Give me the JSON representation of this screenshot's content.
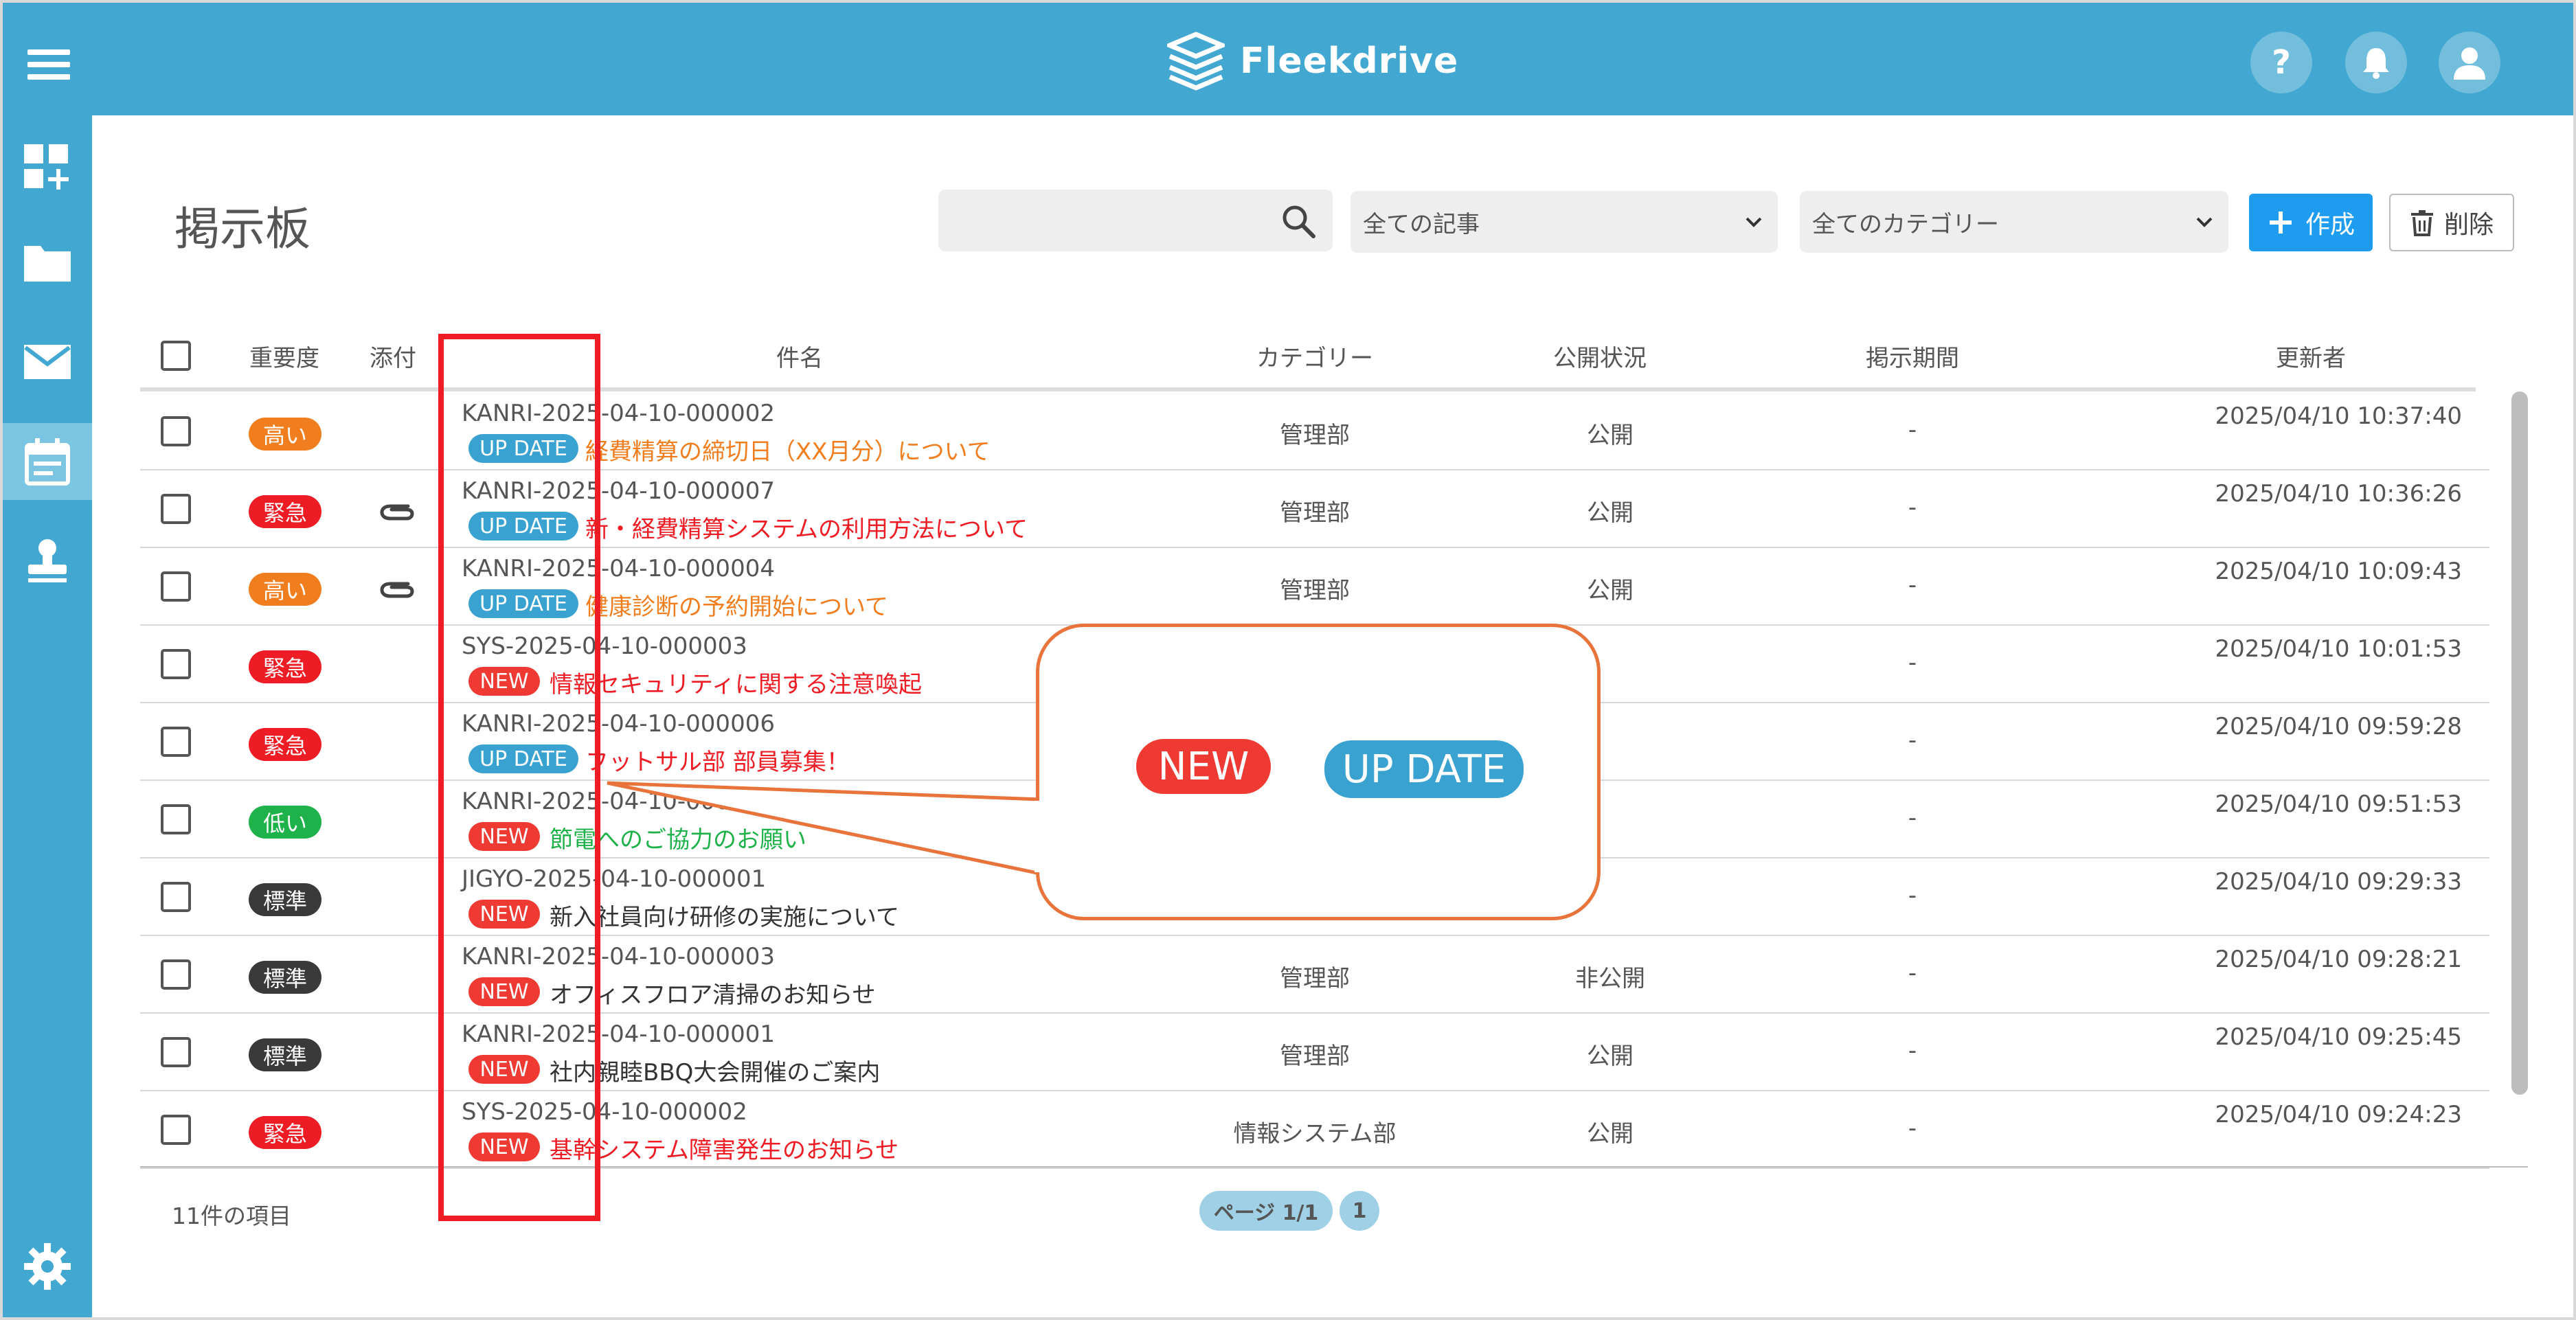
{
  "app": {
    "name": "Fleekdrive"
  },
  "header": {
    "help_label": "?"
  },
  "page": {
    "title": "掲示板"
  },
  "toolbar": {
    "search_placeholder": "",
    "filter_article": "全ての記事",
    "filter_category": "全てのカテゴリー",
    "create_label": "作成",
    "delete_label": "削除"
  },
  "table": {
    "headers": {
      "importance": "重要度",
      "attachment": "添付",
      "subject": "件名",
      "category": "カテゴリー",
      "status": "公開状況",
      "period": "掲示期間",
      "updated_by": "更新者"
    },
    "rows": [
      {
        "priority": "高い",
        "priority_color": "#f07e1e",
        "attach": false,
        "id": "KANRI-2025-04-10-000002",
        "tag": "UP DATE",
        "tag_type": "update",
        "subject": "経費精算の締切日（XX月分）について",
        "subject_color": "#f07e1e",
        "category": "管理部",
        "status": "公開",
        "period": "-",
        "updated": "2025/04/10 10:37:40"
      },
      {
        "priority": "緊急",
        "priority_color": "#ee1c24",
        "attach": true,
        "id": "KANRI-2025-04-10-000007",
        "tag": "UP DATE",
        "tag_type": "update",
        "subject": "新・経費精算システムの利用方法について",
        "subject_color": "#ee1c24",
        "category": "管理部",
        "status": "公開",
        "period": "-",
        "updated": "2025/04/10 10:36:26"
      },
      {
        "priority": "高い",
        "priority_color": "#f07e1e",
        "attach": true,
        "id": "KANRI-2025-04-10-000004",
        "tag": "UP DATE",
        "tag_type": "update",
        "subject": "健康診断の予約開始について",
        "subject_color": "#f07e1e",
        "category": "管理部",
        "status": "公開",
        "period": "-",
        "updated": "2025/04/10 10:09:43"
      },
      {
        "priority": "緊急",
        "priority_color": "#ee1c24",
        "attach": false,
        "id": "SYS-2025-04-10-000003",
        "tag": "NEW",
        "tag_type": "new",
        "subject": "情報セキュリティに関する注意喚起",
        "subject_color": "#ee1c24",
        "category": "",
        "status": "",
        "period": "-",
        "updated": "2025/04/10 10:01:53"
      },
      {
        "priority": "緊急",
        "priority_color": "#ee1c24",
        "attach": false,
        "id": "KANRI-2025-04-10-000006",
        "tag": "UP DATE",
        "tag_type": "update",
        "subject": "フットサル部 部員募集！",
        "subject_color": "#ee1c24",
        "category": "",
        "status": "",
        "period": "-",
        "updated": "2025/04/10 09:59:28"
      },
      {
        "priority": "低い",
        "priority_color": "#1fb24a",
        "attach": false,
        "id": "KANRI-2025-04-10-000005",
        "tag": "NEW",
        "tag_type": "new",
        "subject": "節電へのご協力のお願い",
        "subject_color": "#1fb24a",
        "category": "",
        "status": "",
        "period": "-",
        "updated": "2025/04/10 09:51:53"
      },
      {
        "priority": "標準",
        "priority_color": "#3a3a3a",
        "attach": false,
        "id": "JIGYO-2025-04-10-000001",
        "tag": "NEW",
        "tag_type": "new",
        "subject": "新入社員向け研修の実施について",
        "subject_color": "#333333",
        "category": "",
        "status": "",
        "period": "-",
        "updated": "2025/04/10 09:29:33"
      },
      {
        "priority": "標準",
        "priority_color": "#3a3a3a",
        "attach": false,
        "id": "KANRI-2025-04-10-000003",
        "tag": "NEW",
        "tag_type": "new",
        "subject": "オフィスフロア清掃のお知らせ",
        "subject_color": "#333333",
        "category": "管理部",
        "status": "非公開",
        "period": "-",
        "updated": "2025/04/10 09:28:21"
      },
      {
        "priority": "標準",
        "priority_color": "#3a3a3a",
        "attach": false,
        "id": "KANRI-2025-04-10-000001",
        "tag": "NEW",
        "tag_type": "new",
        "subject": "社内親睦BBQ大会開催のご案内",
        "subject_color": "#333333",
        "category": "管理部",
        "status": "公開",
        "period": "-",
        "updated": "2025/04/10 09:25:45"
      },
      {
        "priority": "緊急",
        "priority_color": "#ee1c24",
        "attach": false,
        "id": "SYS-2025-04-10-000002",
        "tag": "NEW",
        "tag_type": "new",
        "subject": "基幹システム障害発生のお知らせ",
        "subject_color": "#ee1c24",
        "category": "情報システム部",
        "status": "公開",
        "period": "-",
        "updated": "2025/04/10 09:24:23"
      }
    ]
  },
  "footer": {
    "count": "11件の項目",
    "page_label": "ページ 1/1",
    "page_number": "1"
  },
  "callout": {
    "new_label": "NEW",
    "update_label": "UP DATE"
  },
  "colors": {
    "brand": "#43a8d1",
    "primary_button": "#1e9cf0",
    "new_tag": "#ee3a33",
    "update_tag": "#3aa2d0",
    "highlight": "#ee1c24",
    "callout_border": "#e8733b"
  },
  "icons": {
    "menu": "hamburger-icon",
    "help": "help-icon",
    "bell": "bell-icon",
    "user": "user-icon",
    "search": "search-icon",
    "attach": "paperclip-icon",
    "settings": "gear-icon"
  }
}
